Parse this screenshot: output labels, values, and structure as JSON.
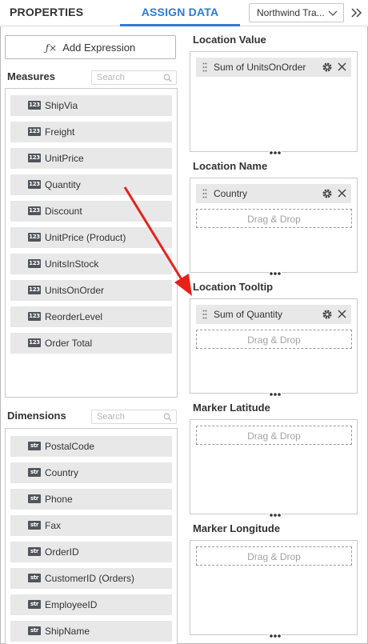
{
  "tabs": {
    "properties": "PROPERTIES",
    "assign_data": "ASSIGN DATA"
  },
  "datasource": {
    "selected": "Northwind Tra..."
  },
  "add_expression": {
    "label": "Add Expression"
  },
  "measures": {
    "title": "Measures",
    "search_placeholder": "Search",
    "badge": "123",
    "items": [
      "ShipVia",
      "Freight",
      "UnitPrice",
      "Quantity",
      "Discount",
      "UnitPrice (Product)",
      "UnitsInStock",
      "UnitsOnOrder",
      "ReorderLevel",
      "Order Total"
    ]
  },
  "dimensions": {
    "title": "Dimensions",
    "search_placeholder": "Search",
    "badge": "str",
    "items": [
      "PostalCode",
      "Country",
      "Phone",
      "Fax",
      "OrderID",
      "CustomerID (Orders)",
      "EmployeeID",
      "ShipName"
    ]
  },
  "drop_label": "Drag & Drop",
  "zones": {
    "location_value": {
      "title": "Location Value",
      "field": "Sum of UnitsOnOrder"
    },
    "location_name": {
      "title": "Location Name",
      "field": "Country"
    },
    "location_tooltip": {
      "title": "Location Tooltip",
      "field": "Sum of Quantity"
    },
    "marker_latitude": {
      "title": "Marker Latitude"
    },
    "marker_longitude": {
      "title": "Marker Longitude"
    }
  },
  "colors": {
    "accent": "#2e7bd8",
    "annotation_arrow": "#e8221b",
    "field_bg": "#e8e8e8",
    "badge_bg": "#50555c"
  }
}
